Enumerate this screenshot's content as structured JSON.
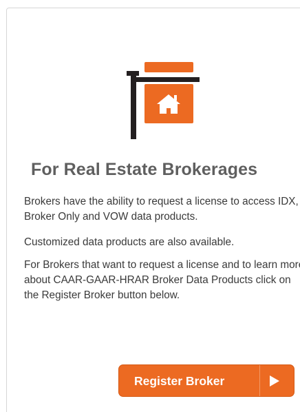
{
  "card": {
    "title": "For Real Estate Brokerages",
    "paragraphs": [
      "Brokers have the ability to request a license to access IDX, Broker Only and VOW data products.",
      "Customized data products are also available.",
      "For Brokers that want to request a license and to learn more about CAAR-GAAR-HRAR Broker Data Products click on the Register Broker button below."
    ],
    "button_label": "Register Broker"
  },
  "colors": {
    "accent": "#ec6a22",
    "title": "#5f5f5f",
    "body_text": "#3a3a3a",
    "sign_post": "#231f20"
  },
  "icons": {
    "hero": "real-estate-sign-icon",
    "button": "play-arrow-icon"
  }
}
